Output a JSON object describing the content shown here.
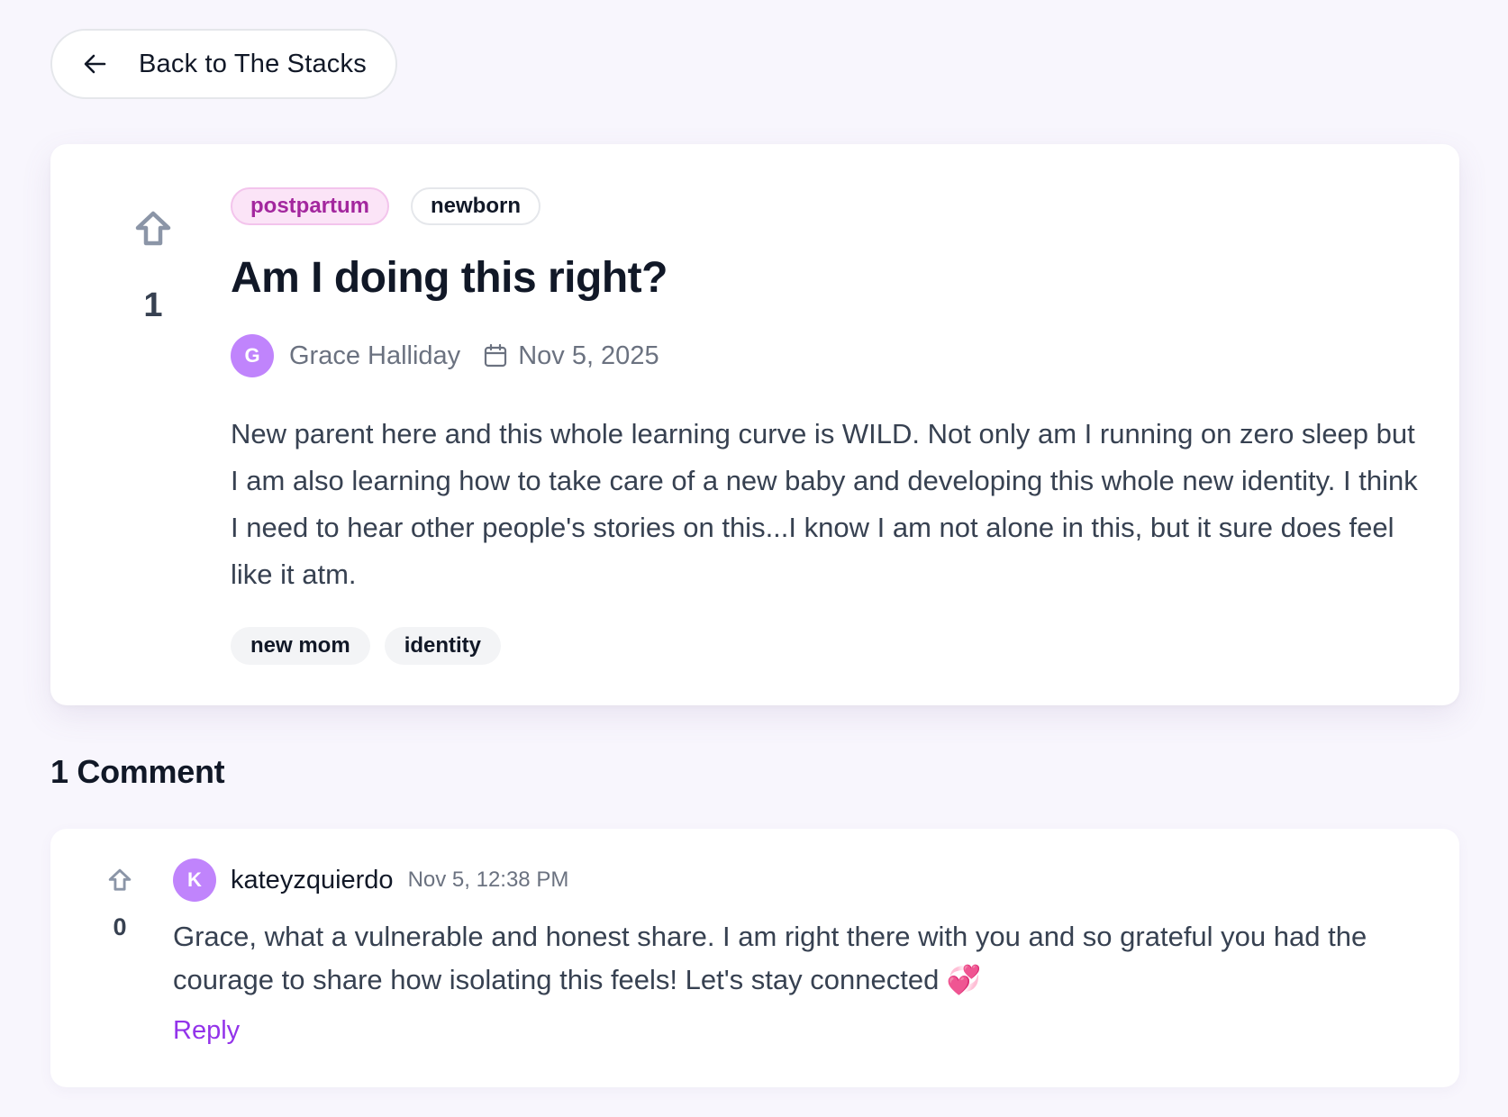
{
  "nav": {
    "back_label": "Back to The Stacks"
  },
  "post": {
    "votes": "1",
    "category_tags": [
      "postpartum",
      "newborn"
    ],
    "title": "Am I doing this right?",
    "author": {
      "initial": "G",
      "name": "Grace Halliday"
    },
    "date": "Nov 5, 2025",
    "body": "New parent here and this whole learning curve is WILD. Not only am I running on zero sleep but I am also learning how to take care of a new baby and developing this whole new identity. I think I need to hear other people's stories on this...I know I am not alone in this, but it sure does feel like it atm.",
    "hashtags": [
      "new mom",
      "identity"
    ]
  },
  "comments": {
    "heading": "1 Comment",
    "items": [
      {
        "votes": "0",
        "author_initial": "K",
        "author": "kateyzquierdo",
        "time": "Nov 5, 12:38 PM",
        "body": "Grace, what a vulnerable and honest share. I am right there with you and so grateful you had the courage to share how isolating this feels! Let's stay connected 💞",
        "reply_label": "Reply"
      }
    ]
  },
  "icons": {
    "back": "arrow-left-icon",
    "upvote": "arrow-up-outline-icon",
    "calendar": "calendar-icon"
  },
  "colors": {
    "background": "#f8f6fd",
    "accent_purple": "#9333ea",
    "avatar": "#c084fc",
    "tag_pink_bg": "#fbe4f7",
    "tag_pink_text": "#a3279e"
  }
}
